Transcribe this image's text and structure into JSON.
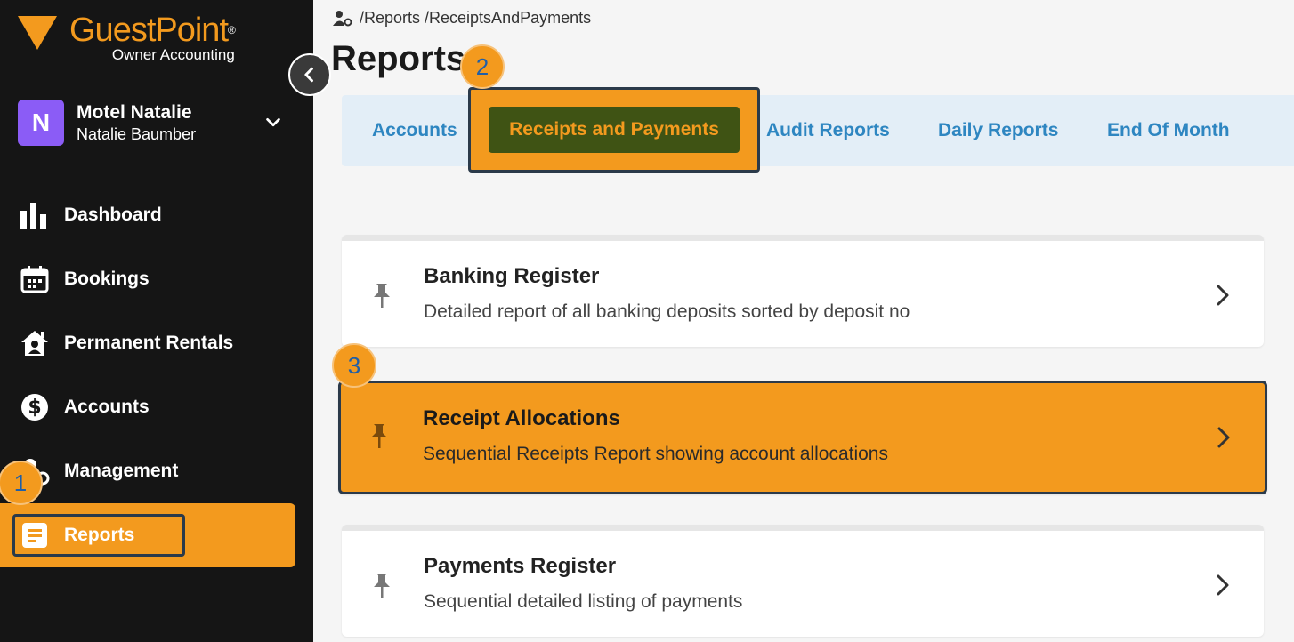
{
  "brand": {
    "name": "GuestPoint",
    "trademark": "®",
    "sub": "Owner Accounting"
  },
  "user": {
    "initial": "N",
    "name": "Motel Natalie",
    "subname": "Natalie Baumber"
  },
  "nav": {
    "items": [
      {
        "label": "Dashboard",
        "icon": "bar-chart-icon"
      },
      {
        "label": "Bookings",
        "icon": "calendar-icon"
      },
      {
        "label": "Permanent Rentals",
        "icon": "house-user-icon"
      },
      {
        "label": "Accounts",
        "icon": "dollar-circle-icon"
      },
      {
        "label": "Management",
        "icon": "user-gear-icon"
      },
      {
        "label": "Reports",
        "icon": "report-icon",
        "active": true
      }
    ]
  },
  "steps": {
    "one": "1",
    "two": "2",
    "three": "3"
  },
  "breadcrumb": {
    "text": "/Reports /ReceiptsAndPayments"
  },
  "page": {
    "title": "Reports"
  },
  "tabs": {
    "accounts": "Accounts",
    "receipts": "Receipts and Payments",
    "audit": "Audit Reports",
    "daily": "Daily Reports",
    "eom": "End Of Month"
  },
  "reports": [
    {
      "title": "Banking Register",
      "desc": "Detailed report of all banking deposits sorted by deposit no"
    },
    {
      "title": "Receipt Allocations",
      "desc": "Sequential Receipts Report showing account allocations"
    },
    {
      "title": "Payments Register",
      "desc": "Sequential detailed listing of payments"
    }
  ],
  "colors": {
    "accent": "#f39a1e",
    "sidebar": "#151515",
    "tab_text": "#2e86c1",
    "tab_active_bg": "#3f5314",
    "tabbar_bg": "#e3eef7"
  }
}
